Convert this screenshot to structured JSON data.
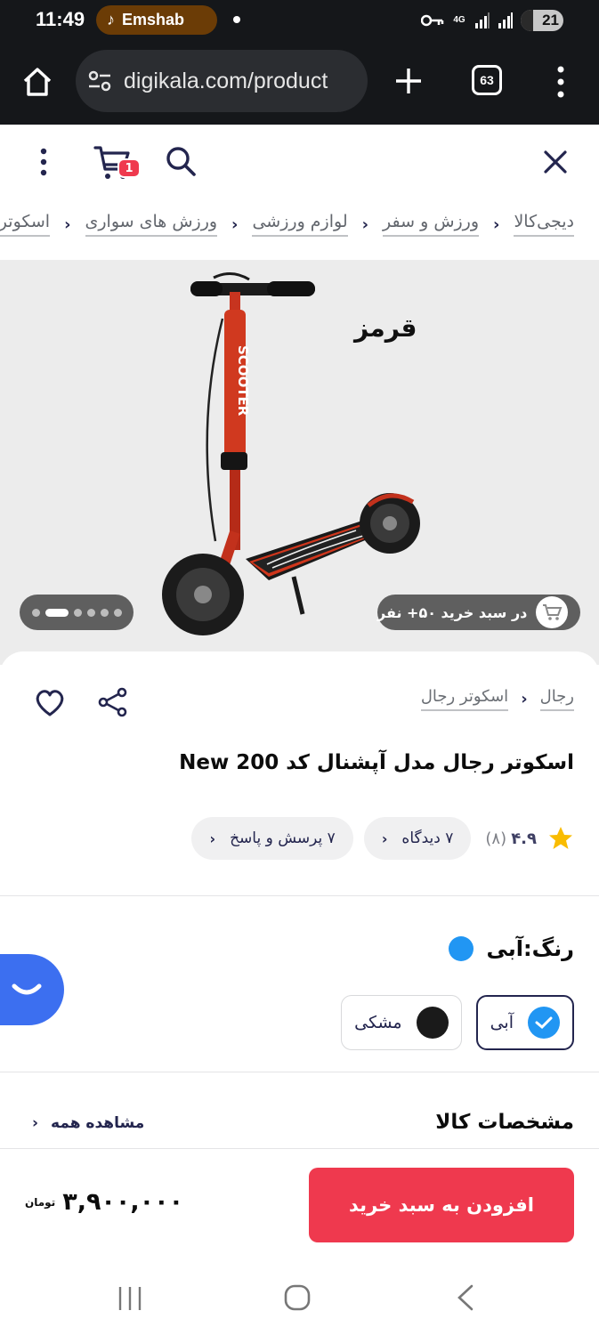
{
  "status": {
    "time": "11:49",
    "media_app": "Emshab",
    "network": "4G",
    "battery": "21"
  },
  "browser": {
    "url": "digikala.com/product",
    "tab_count": "63"
  },
  "header": {
    "cart_count": "1"
  },
  "breadcrumb": [
    {
      "label": "دیجی‌کالا"
    },
    {
      "label": "ورزش و سفر"
    },
    {
      "label": "لوازم ورزشی"
    },
    {
      "label": "ورزش های سواری"
    },
    {
      "label": "اسکوتر"
    }
  ],
  "gallery": {
    "image_caption": "قرمز",
    "social_proof": "در سبد خرید ۵۰+ نفر"
  },
  "product": {
    "breadcrumb": [
      "رجال",
      "اسکوتر رجال"
    ],
    "title": "اسکوتر رجال مدل آپشنال کد New 200",
    "rating": "۴.۹",
    "rating_count": "(۸)",
    "reviews_chip": "۷ دیدگاه",
    "questions_chip": "۷ پرسش و پاسخ"
  },
  "color": {
    "label": "رنگ:",
    "selected_name": "آبی",
    "options": [
      {
        "name": "آبی",
        "hex": "#2196f3",
        "selected": true
      },
      {
        "name": "مشکی",
        "hex": "#1a1a1a",
        "selected": false
      }
    ]
  },
  "specs": {
    "title": "مشخصات کالا",
    "see_all": "مشاهده همه"
  },
  "purchase": {
    "price": "۳,۹۰۰,۰۰۰",
    "unit": "تومان",
    "add_to_cart": "افزودن به سبد خرید"
  },
  "colors": {
    "brand_red": "#ef394e",
    "chat_blue": "#3c6ff0",
    "star": "#f9bc00"
  }
}
